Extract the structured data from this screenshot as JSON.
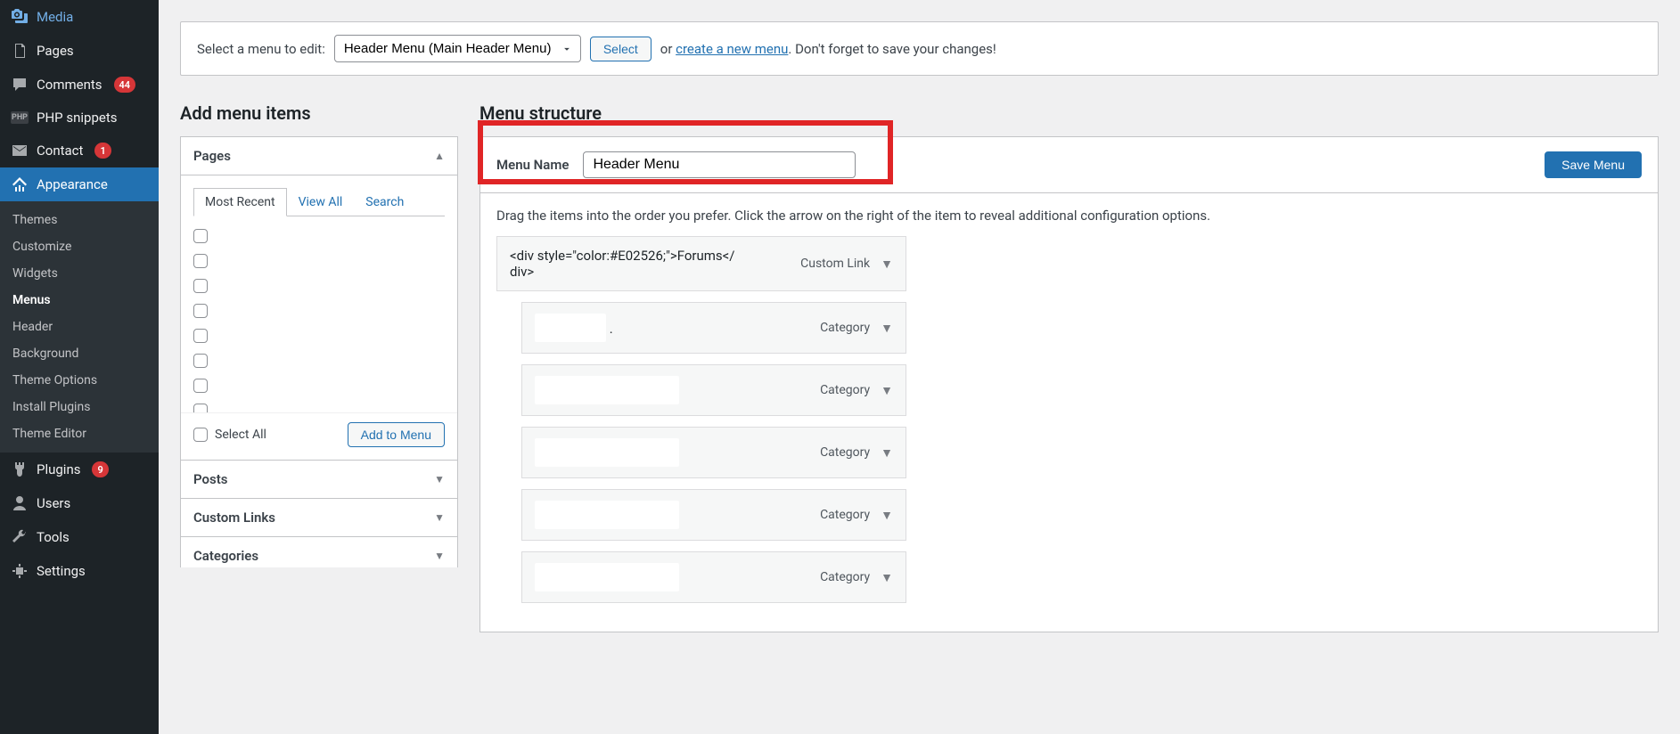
{
  "sidebar": {
    "media": {
      "label": "Media"
    },
    "pages": {
      "label": "Pages"
    },
    "comments": {
      "label": "Comments",
      "badge": "44"
    },
    "php_snippets": {
      "label": "PHP snippets"
    },
    "contact": {
      "label": "Contact",
      "badge": "1"
    },
    "appearance": {
      "label": "Appearance"
    },
    "plugins": {
      "label": "Plugins",
      "badge": "9"
    },
    "users": {
      "label": "Users"
    },
    "tools": {
      "label": "Tools"
    },
    "settings": {
      "label": "Settings"
    },
    "appearance_submenu": {
      "themes": "Themes",
      "customize": "Customize",
      "widgets": "Widgets",
      "menus": "Menus",
      "header": "Header",
      "background": "Background",
      "theme_options": "Theme Options",
      "install_plugins": "Install Plugins",
      "theme_editor": "Theme Editor"
    }
  },
  "topbar": {
    "prompt": "Select a menu to edit:",
    "selected": "Header Menu (Main Header Menu)",
    "select_btn": "Select",
    "or": "or ",
    "create_link": "create a new menu",
    "tail": ". Don't forget to save your changes!"
  },
  "headings": {
    "add_items": "Add menu items",
    "structure": "Menu structure"
  },
  "metaboxes": {
    "pages": {
      "title": "Pages",
      "tabs": {
        "recent": "Most Recent",
        "view_all": "View All",
        "search": "Search"
      },
      "select_all": "Select All",
      "add_btn": "Add to Menu"
    },
    "posts": {
      "title": "Posts"
    },
    "custom_links": {
      "title": "Custom Links"
    },
    "categories": {
      "title": "Categories"
    }
  },
  "panel": {
    "menu_name_label": "Menu Name",
    "menu_name_value": "Header Menu",
    "save_btn": "Save Menu",
    "instructions": "Drag the items into the order you prefer. Click the arrow on the right of the item to reveal additional configuration options."
  },
  "menu_items": [
    {
      "title": "<div style=\"color:#E02526;\">Forums</div>",
      "type": "Custom Link",
      "sub": false
    },
    {
      "title": ".",
      "type": "Category",
      "sub": true,
      "blurred": true,
      "blur_w": "short"
    },
    {
      "title": "",
      "type": "Category",
      "sub": true,
      "blurred": true,
      "blur_w": "wide"
    },
    {
      "title": "",
      "type": "Category",
      "sub": true,
      "blurred": true,
      "blur_w": "wide"
    },
    {
      "title": "",
      "type": "Category",
      "sub": true,
      "blurred": true,
      "blur_w": "wide"
    },
    {
      "title": "",
      "type": "Category",
      "sub": true,
      "blurred": true,
      "blur_w": "wide"
    }
  ]
}
